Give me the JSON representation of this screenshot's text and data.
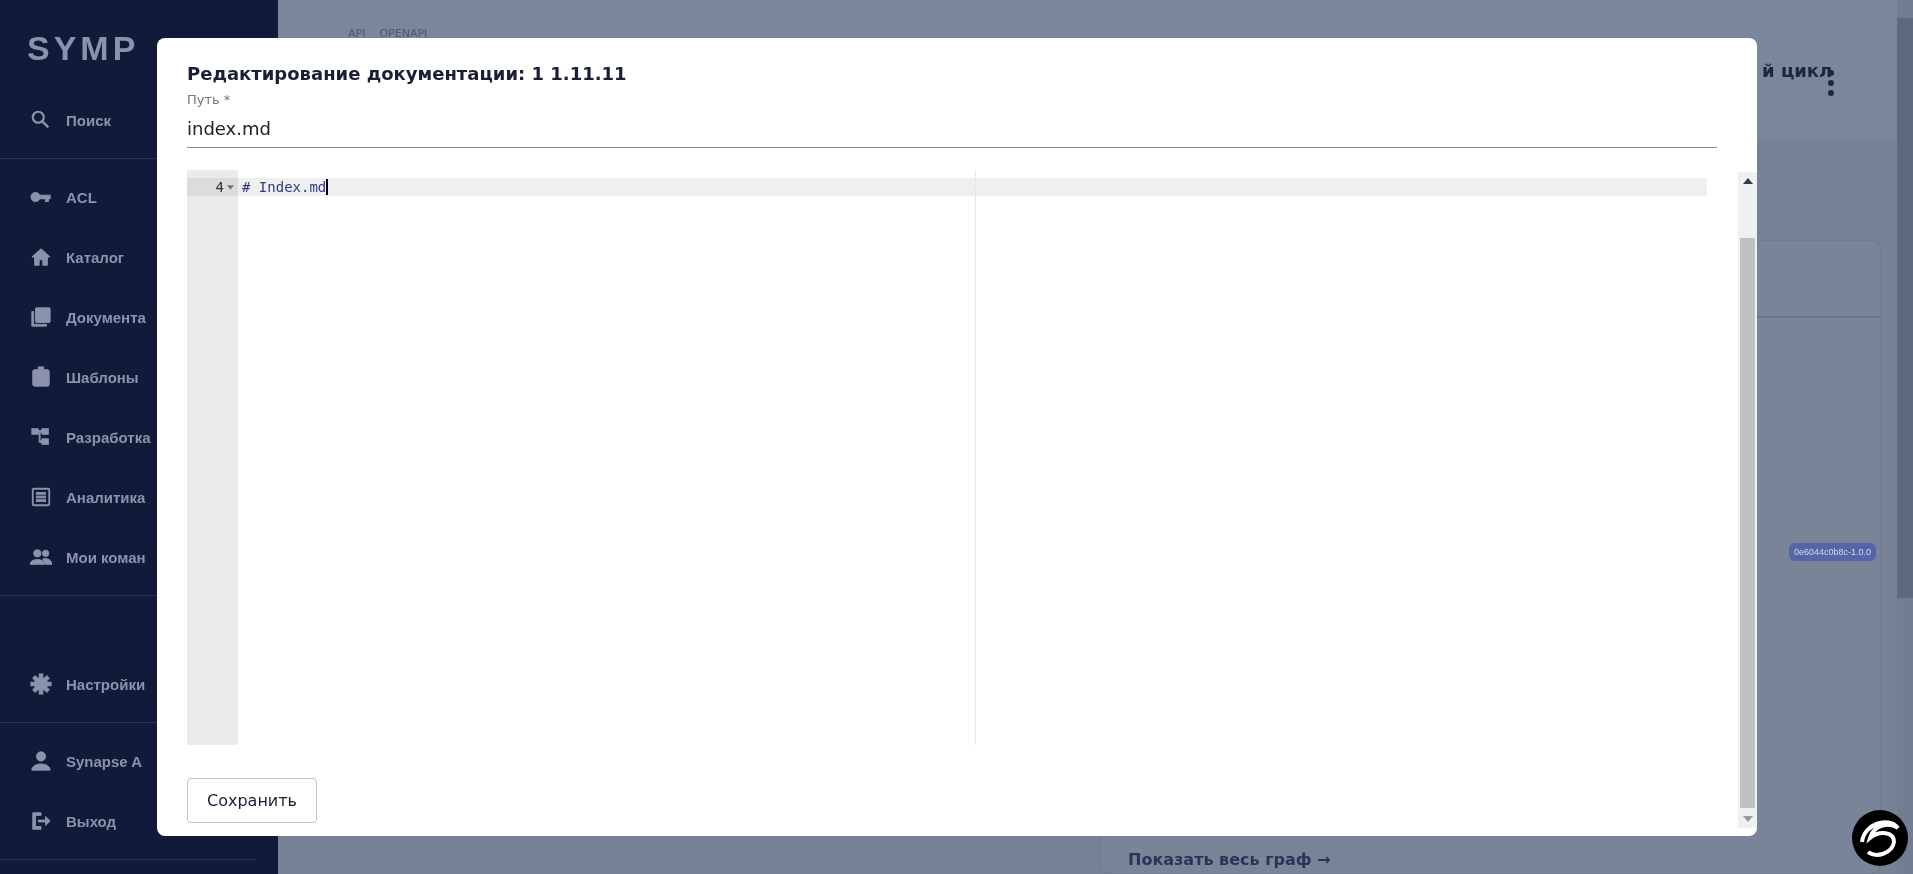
{
  "sidebar": {
    "logo": "SYMP",
    "groups": [
      {
        "items": [
          {
            "label": "Поиск"
          }
        ]
      },
      {
        "items": [
          {
            "label": "ACL"
          },
          {
            "label": "Каталог"
          },
          {
            "label": "Документа"
          },
          {
            "label": "Шаблоны"
          },
          {
            "label": "Разработка"
          },
          {
            "label": "Аналитика"
          },
          {
            "label": "Мои коман"
          }
        ]
      },
      {
        "items": [
          {
            "label": "Настройки"
          }
        ]
      },
      {
        "items": [
          {
            "label": "Synapse A"
          },
          {
            "label": "Выход"
          }
        ]
      }
    ]
  },
  "page": {
    "breadcrumbs": [
      "API",
      "OPENAPI"
    ],
    "title": "й цикл",
    "tag": "0e6044c0b8c-1.0.0",
    "link": "Показать весь граф →"
  },
  "dialog": {
    "title": "Редактирование документации: 1 1.11.11",
    "path_field": {
      "label": "Путь *",
      "value": "index.md"
    },
    "editor": {
      "lines": [
        {
          "number": "4",
          "text": "# Index.md",
          "active": true
        }
      ]
    },
    "buttons": [
      "Сохранить"
    ]
  }
}
